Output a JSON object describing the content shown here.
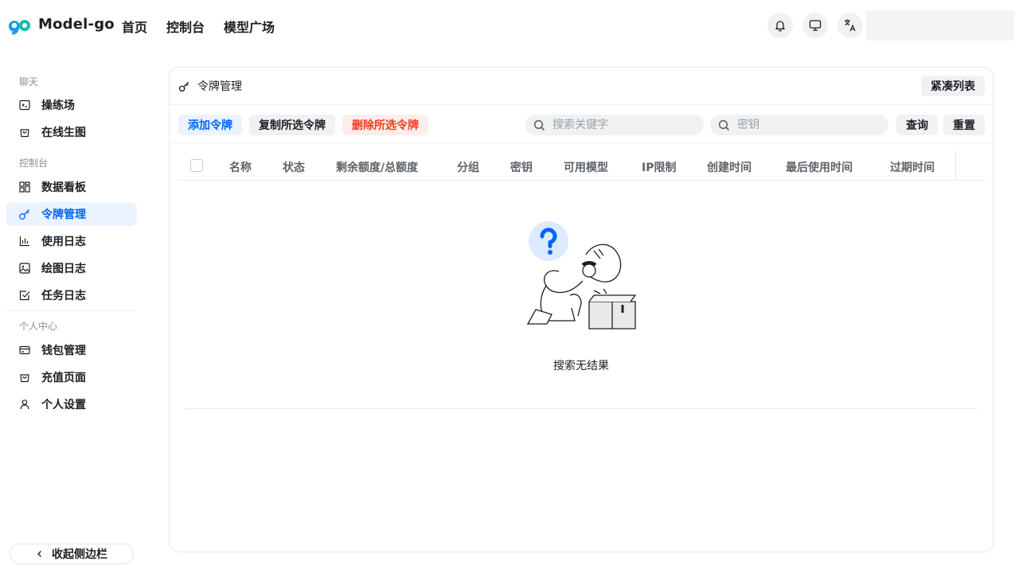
{
  "app": {
    "brand": "Model-go",
    "nav": [
      "首页",
      "控制台",
      "模型广场"
    ]
  },
  "header_icons": [
    "bell-icon",
    "monitor-icon",
    "translate-icon"
  ],
  "sidebar": {
    "sections": [
      {
        "title": "聊天",
        "items": [
          {
            "label": "操练场",
            "icon": "terminal-icon"
          },
          {
            "label": "在线生图",
            "icon": "shopping-bag-icon"
          }
        ]
      },
      {
        "title": "控制台",
        "items": [
          {
            "label": "数据看板",
            "icon": "dashboard-grid-icon"
          },
          {
            "label": "令牌管理",
            "icon": "key-icon",
            "active": true
          },
          {
            "label": "使用日志",
            "icon": "bar-chart-icon"
          },
          {
            "label": "绘图日志",
            "icon": "image-icon"
          },
          {
            "label": "任务日志",
            "icon": "checkbox-icon"
          }
        ]
      },
      {
        "title": "个人中心",
        "items": [
          {
            "label": "钱包管理",
            "icon": "credit-card-icon"
          },
          {
            "label": "充值页面",
            "icon": "shopping-bag-icon"
          },
          {
            "label": "个人设置",
            "icon": "user-icon"
          }
        ]
      }
    ],
    "collapse_label": "收起侧边栏"
  },
  "page": {
    "title": "令牌管理",
    "compact_label": "紧凑列表",
    "actions": {
      "add": "添加令牌",
      "copy": "复制所选令牌",
      "delete": "删除所选令牌"
    },
    "search_keyword_placeholder": "搜索关键字",
    "search_key_placeholder": "密钥",
    "query_label": "查询",
    "reset_label": "重置"
  },
  "table": {
    "columns": [
      "名称",
      "状态",
      "剩余额度/总额度",
      "分组",
      "密钥",
      "可用模型",
      "IP限制",
      "创建时间",
      "最后使用时间",
      "过期时间"
    ],
    "rows": [],
    "empty_text": "搜索无结果"
  },
  "colors": {
    "accent": "#0064fa",
    "danger": "#f93920",
    "active_bg": "#eaf3ff"
  }
}
